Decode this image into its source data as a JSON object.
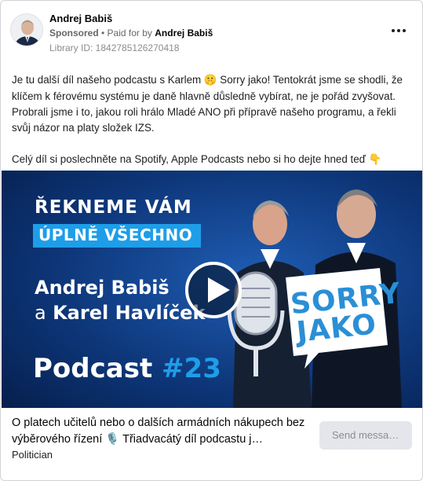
{
  "post": {
    "author": "Andrej Babiš",
    "sponsored_label": "Sponsored",
    "paid_for_prefix": " • Paid for by ",
    "paid_for_name": "Andrej Babiš",
    "library_id": "Library ID: 1842785126270418",
    "more_icon": "more-horizontal-icon",
    "paragraph1_part1": "Je tu další díl našeho podcastu s Karlem ",
    "paragraph1_emoji": "🤫",
    "paragraph1_part2": " Sorry jako! Tentokrát jsme se shodli, že klíčem k férovému systému je daně hlavně důsledně vybírat, ne je pořád zvyšovat. Probrali jsme i to, jakou roli hrálo Mladé ANO při přípravě našeho programu, a řekli svůj názor na platy složek IZS.",
    "paragraph2": "Celý díl si poslechněte na Spotify, Apple Podcasts nebo si ho dejte hned teď ",
    "paragraph2_emoji": "👇"
  },
  "banner": {
    "line1": "ŘEKNEME VÁM",
    "line2": "ÚPLNĚ VŠECHNO",
    "line3": "Andrej Babiš",
    "line4_a": "a",
    "line4_name": "Karel Havlíček",
    "podcast_word": "Podcast",
    "podcast_number": "#23",
    "logo_line1": "SORRY",
    "logo_line2": "JAKO",
    "play_icon": "play-icon",
    "colors": {
      "background": "#0a2d66",
      "accent": "#1e9ee8"
    }
  },
  "footer": {
    "title": "O platech učitelů nebo o dalších armádních nákupech bez výběrového řízení 🎙️ Třiadvacátý díl podcastu j…",
    "subtitle": "Politician",
    "send_button": "Send messa…"
  }
}
